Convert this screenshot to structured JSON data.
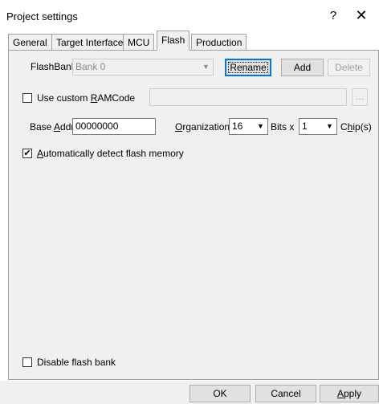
{
  "window": {
    "title": "Project settings",
    "help_label": "?",
    "close_label": "✕"
  },
  "tabs": [
    {
      "label": "General",
      "active": false
    },
    {
      "label": "Target Interface",
      "active": false
    },
    {
      "label": "MCU",
      "active": false
    },
    {
      "label": "Flash",
      "active": true
    },
    {
      "label": "Production",
      "active": false
    }
  ],
  "flashbank": {
    "label": "FlashBank",
    "selected": "Bank 0",
    "rename_label": "Rename",
    "add_label": "Add",
    "delete_label": "Delete"
  },
  "ramcode": {
    "checkbox_label_pre": "Use custom ",
    "checkbox_label_ul": "R",
    "checkbox_label_post": "AMCode",
    "checked": false,
    "path_value": "",
    "browse_label": "..."
  },
  "base": {
    "label_pre": "Base ",
    "label_ul": "A",
    "label_post": "ddr",
    "value": "00000000",
    "organization_ul": "O",
    "organization_post": "rganization",
    "organization_value": "16",
    "bits_label": "Bits x",
    "chips_value": "1",
    "chips_pre": "C",
    "chips_ul": "h",
    "chips_post": "ip(s)"
  },
  "auto_detect": {
    "label_ul": "A",
    "label_post": "utomatically detect flash memory",
    "checked": true
  },
  "disable_bank": {
    "label": "Disable flash bank",
    "checked": false
  },
  "footer": {
    "ok_label": "OK",
    "cancel_label": "Cancel",
    "apply_ul": "A",
    "apply_post": "pply"
  }
}
